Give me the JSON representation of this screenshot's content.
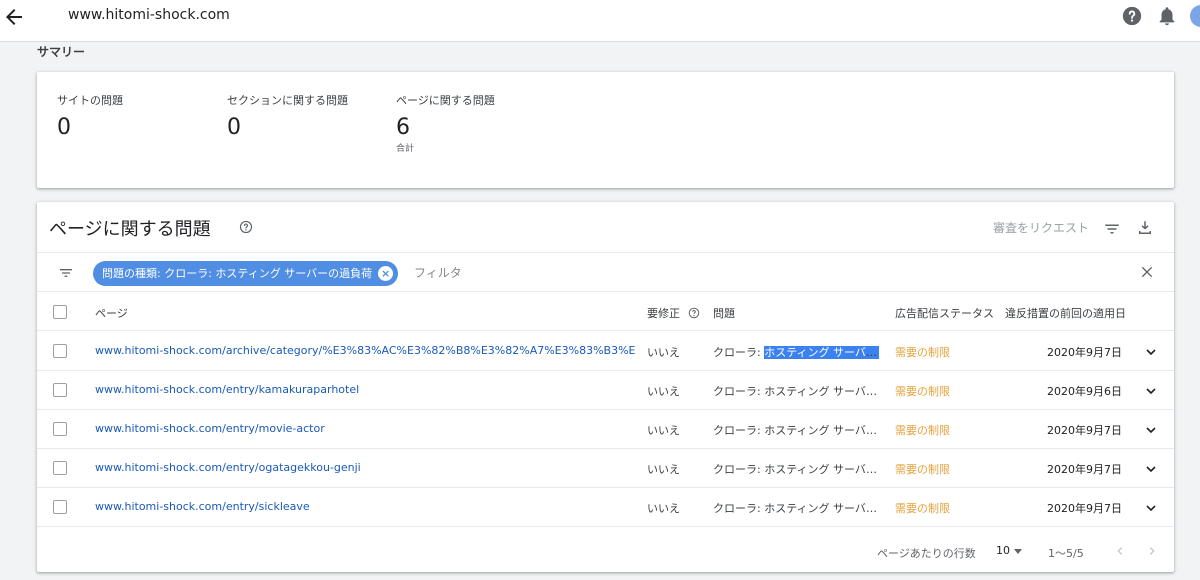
{
  "topbar": {
    "site": "www.hitomi-shock.com",
    "back_icon": "arrow-back-icon",
    "help_icon": "help-icon",
    "notifications_icon": "bell-icon"
  },
  "summary": {
    "section_label": "サマリー",
    "stats": [
      {
        "label": "サイトの問題",
        "value": "0",
        "sub": ""
      },
      {
        "label": "セクションに関する問題",
        "value": "0",
        "sub": ""
      },
      {
        "label": "ページに関する問題",
        "value": "6",
        "sub": "合計"
      }
    ]
  },
  "issues": {
    "title": "ページに関する問題",
    "request_review": "審査をリクエスト",
    "filter_chip": "問題の種類: クローラ: ホスティング サーバーの過負荷",
    "filter_placeholder": "フィルタ",
    "columns": {
      "page": "ページ",
      "needs_fix": "要修正",
      "issue": "問題",
      "ad_status": "広告配信ステータス",
      "last_enforced": "違反措置の前回の適用日"
    },
    "rows": [
      {
        "url": "www.hitomi-shock.com/archive/category/%E3%83%AC%E3%82%B8%E3%82%A7%E3%83%B3%E3%83%8...",
        "fix": "いいえ",
        "issue_prefix": "クローラ: ",
        "issue_rest": "ホスティング サーバー…",
        "status": "需要の制限",
        "date": "2020年9月7日"
      },
      {
        "url": "www.hitomi-shock.com/entry/kamakuraparhotel",
        "fix": "いいえ",
        "issue_prefix": "クローラ: ",
        "issue_rest": "ホスティング サーバー…",
        "status": "需要の制限",
        "date": "2020年9月6日"
      },
      {
        "url": "www.hitomi-shock.com/entry/movie-actor",
        "fix": "いいえ",
        "issue_prefix": "クローラ: ",
        "issue_rest": "ホスティング サーバー…",
        "status": "需要の制限",
        "date": "2020年9月7日"
      },
      {
        "url": "www.hitomi-shock.com/entry/ogatagekkou-genji",
        "fix": "いいえ",
        "issue_prefix": "クローラ: ",
        "issue_rest": "ホスティング サーバー…",
        "status": "需要の制限",
        "date": "2020年9月7日"
      },
      {
        "url": "www.hitomi-shock.com/entry/sickleave",
        "fix": "いいえ",
        "issue_prefix": "クローラ: ",
        "issue_rest": "ホスティング サーバー…",
        "status": "需要の制限",
        "date": "2020年9月7日"
      }
    ],
    "footer": {
      "rows_per_page_label": "ページあたりの行数",
      "rows_per_page": "10",
      "range": "1〜5/5"
    }
  },
  "colors": {
    "link": "#1a5ab8",
    "status": "#e6a23c",
    "chip": "#4f8ee3",
    "highlight": "#3b82f0"
  }
}
